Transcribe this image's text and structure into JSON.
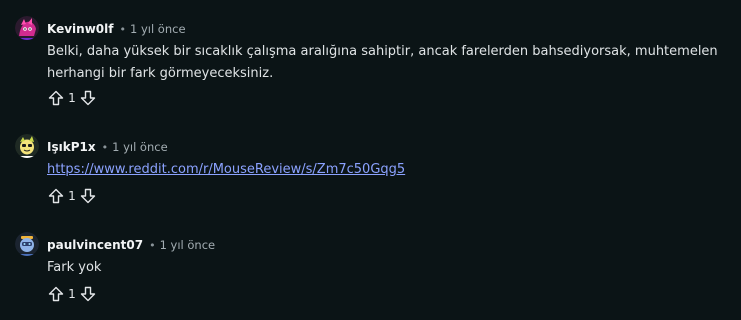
{
  "comments": [
    {
      "username": "Kevinw0lf",
      "separator": "•",
      "time": "1 yıl önce",
      "avatar_icon": "pink-character-avatar",
      "body": "Belki, daha yüksek bir sıcaklık çalışma aralığına sahiptir, ancak farelerden bahsediyorsak, muhtemelen herhangi bir fark görmeyeceksiniz.",
      "votes": "1",
      "upvote_icon": "arrow-up-icon",
      "downvote_icon": "arrow-down-icon"
    },
    {
      "username": "IşıkP1x",
      "separator": "•",
      "time": "1 yıl önce",
      "avatar_icon": "yellow-character-avatar",
      "link": "https://www.reddit.com/r/MouseReview/s/Zm7c50Gqg5",
      "votes": "1",
      "upvote_icon": "arrow-up-icon",
      "downvote_icon": "arrow-down-icon"
    },
    {
      "username": "paulvincent07",
      "separator": "•",
      "time": "1 yıl önce",
      "avatar_icon": "blue-character-avatar",
      "body": "Fark yok",
      "votes": "1",
      "upvote_icon": "arrow-up-icon",
      "downvote_icon": "arrow-down-icon"
    }
  ],
  "colors": {
    "background": "#0b1416",
    "link": "#8ba2ff",
    "text": "#dfe3e5",
    "muted": "#a3adb2"
  }
}
